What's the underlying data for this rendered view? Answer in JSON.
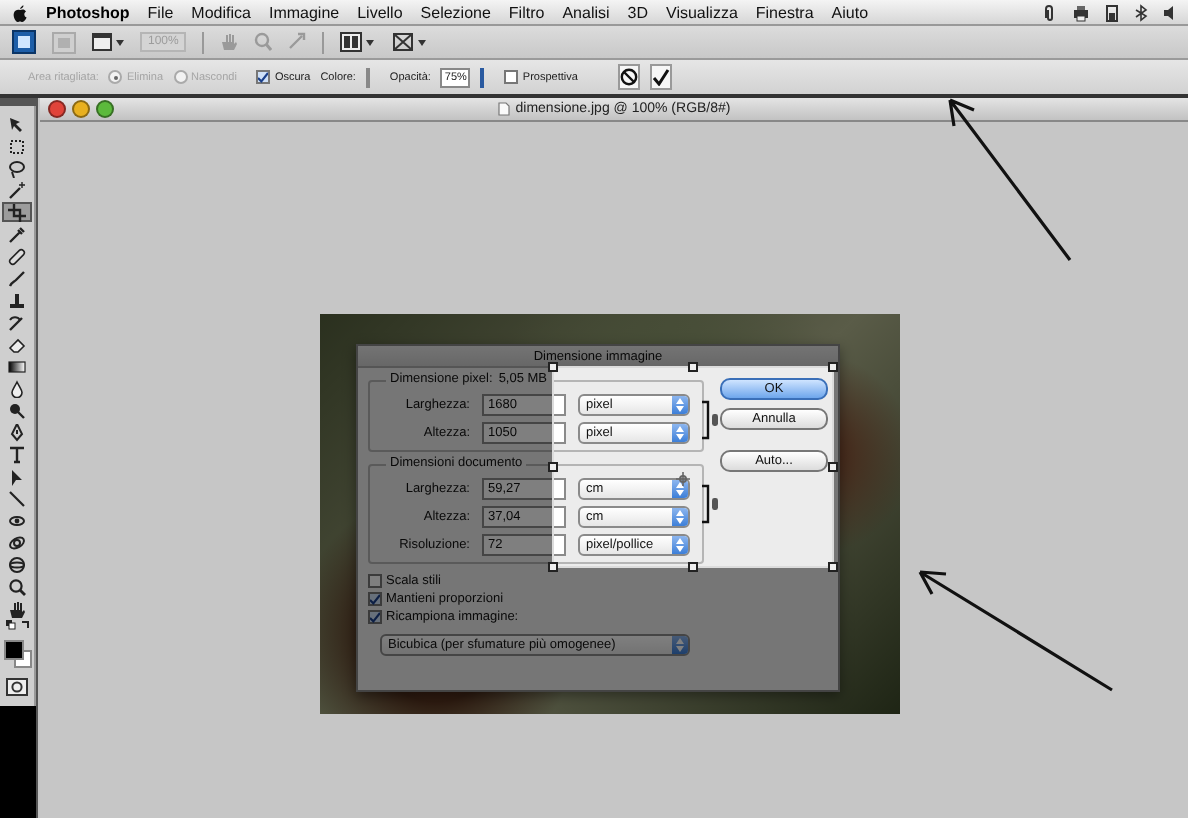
{
  "menu_bar": {
    "app": "Photoshop",
    "items": [
      "File",
      "Modifica",
      "Immagine",
      "Livello",
      "Selezione",
      "Filtro",
      "Analisi",
      "3D",
      "Visualizza",
      "Finestra",
      "Aiuto"
    ]
  },
  "app_bar": {
    "zoom": "100%",
    "zoom_disabled": true
  },
  "options_bar": {
    "area_label": "Area ritagliata:",
    "area_disabled": true,
    "area_options": [
      {
        "label": "Elimina",
        "selected": true
      },
      {
        "label": "Nascondi",
        "selected": false
      }
    ],
    "shield": {
      "label": "Oscura",
      "checked": true
    },
    "color_label": "Colore:",
    "opacity_label": "Opacità:",
    "opacity": "75%",
    "perspective": {
      "label": "Prospettiva",
      "checked": false
    }
  },
  "toolbox": {
    "tools": [
      {
        "selected": false
      },
      {
        "selected": false
      },
      {
        "selected": false
      },
      {
        "selected": false
      },
      {
        "selected": true
      },
      {
        "selected": false
      },
      {
        "selected": false
      },
      {
        "selected": false
      },
      {
        "selected": false
      },
      {
        "selected": false
      },
      {
        "selected": false
      },
      {
        "selected": false
      },
      {
        "selected": false
      },
      {
        "selected": false
      },
      {
        "selected": false
      },
      {
        "selected": false
      },
      {
        "selected": false
      },
      {
        "selected": false
      },
      {
        "selected": false
      },
      {
        "selected": false
      },
      {
        "selected": false
      },
      {
        "selected": false
      },
      {
        "selected": false
      }
    ]
  },
  "document": {
    "title": "dimensione.jpg @ 100% (RGB/8#)"
  },
  "dialog": {
    "title": "Dimensione immagine",
    "pixel_dimensions": {
      "label": "Dimensione pixel:",
      "size": "5,05 MB",
      "rows": [
        {
          "label": "Larghezza:",
          "value": "1680",
          "unit": "pixel"
        },
        {
          "label": "Altezza:",
          "value": "1050",
          "unit": "pixel"
        }
      ]
    },
    "document_size": {
      "label": "Dimensioni documento",
      "rows": [
        {
          "label": "Larghezza:",
          "value": "59,27",
          "unit": "cm"
        },
        {
          "label": "Altezza:",
          "value": "37,04",
          "unit": "cm"
        },
        {
          "label": "Risoluzione:",
          "value": "72",
          "unit": "pixel/pollice"
        }
      ]
    },
    "options": [
      {
        "label": "Scala stili",
        "checked": false
      },
      {
        "label": "Mantieni proporzioni",
        "checked": true
      },
      {
        "label": "Ricampiona immagine:",
        "checked": true
      }
    ],
    "resample": "Bicubica (per sfumature più omogenee)",
    "buttons": [
      {
        "label": "OK",
        "default": true
      },
      {
        "label": "Annulla",
        "default": false
      },
      {
        "label": "Auto...",
        "default": false
      }
    ]
  }
}
